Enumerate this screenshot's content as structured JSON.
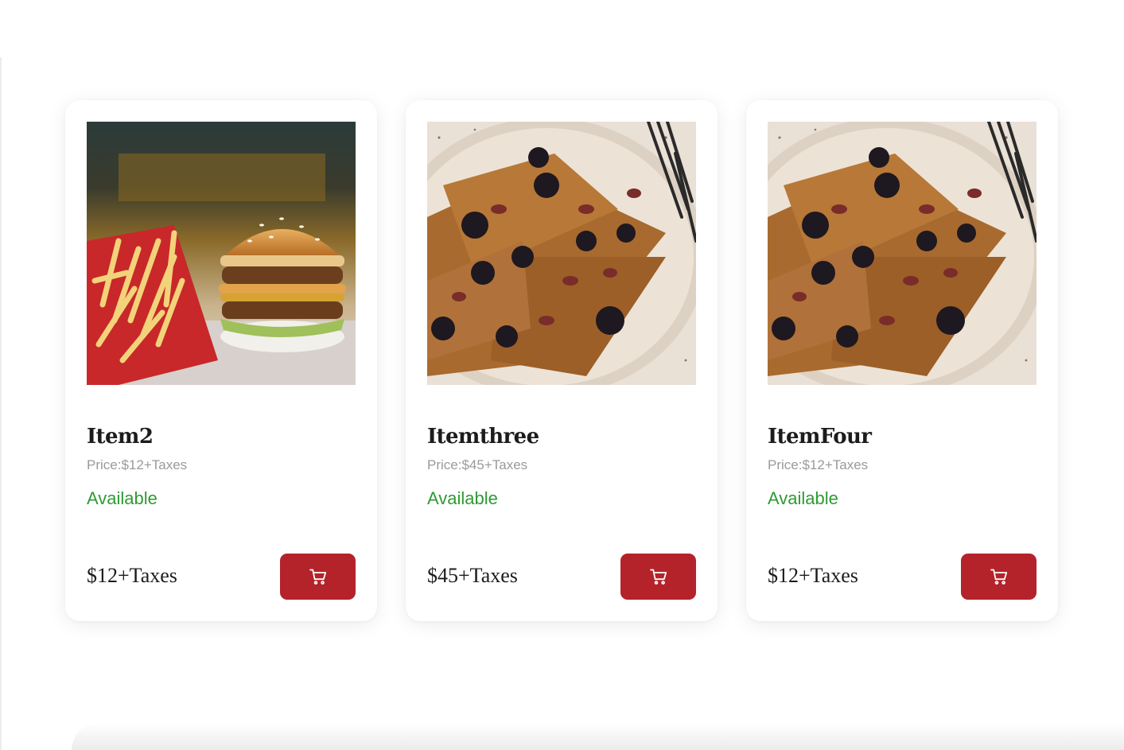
{
  "theme": {
    "accent": "#b4232a",
    "available_color": "#2e9a33"
  },
  "products": [
    {
      "name": "Item2",
      "price_line": "Price:$12+Taxes",
      "status": "Available",
      "footer_price": "$12+Taxes",
      "image": "burger-and-fries",
      "cart_icon": "shopping-cart-icon"
    },
    {
      "name": "Itemthree",
      "price_line": "Price:$45+Taxes",
      "status": "Available",
      "footer_price": "$45+Taxes",
      "image": "french-toast-with-berries",
      "cart_icon": "shopping-cart-icon"
    },
    {
      "name": "ItemFour",
      "price_line": "Price:$12+Taxes",
      "status": "Available",
      "footer_price": "$12+Taxes",
      "image": "french-toast-with-berries",
      "cart_icon": "shopping-cart-icon"
    }
  ]
}
